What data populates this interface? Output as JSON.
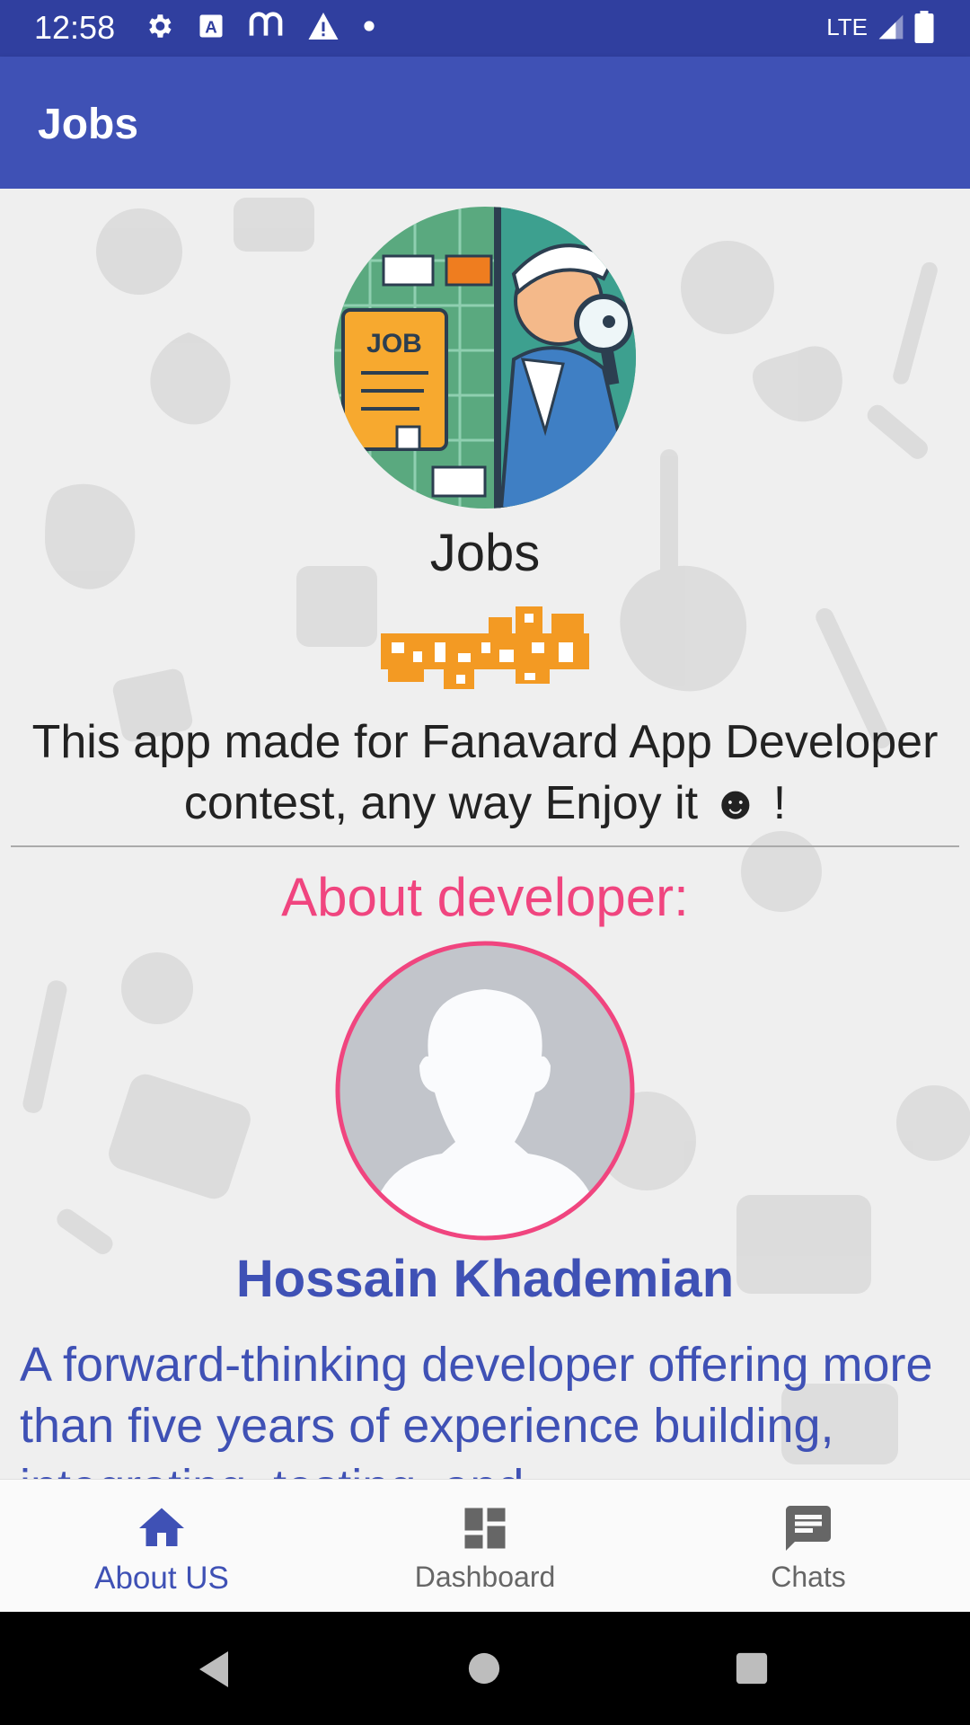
{
  "status_bar": {
    "time": "12:58",
    "network": "LTE"
  },
  "app_bar": {
    "title": "Jobs"
  },
  "content": {
    "app_name": "Jobs",
    "logo_card_text": "JOB",
    "description": "This app made for Fanavard App Developer contest, any way Enjoy it ☻ !",
    "about_title": "About developer:",
    "developer_name": "Hossain Khademian",
    "bio": "A forward-thinking developer offering more than five years of experience building, integrating, testing, and"
  },
  "bottom_nav": {
    "items": [
      {
        "label": "About US",
        "icon": "home-icon",
        "active": true
      },
      {
        "label": "Dashboard",
        "icon": "dashboard-icon",
        "active": false
      },
      {
        "label": "Chats",
        "icon": "chat-icon",
        "active": false
      }
    ]
  },
  "colors": {
    "primary": "#3f51b5",
    "primary_dark": "#303f9f",
    "accent": "#f0457f",
    "fanavard_orange": "#f39a23"
  }
}
